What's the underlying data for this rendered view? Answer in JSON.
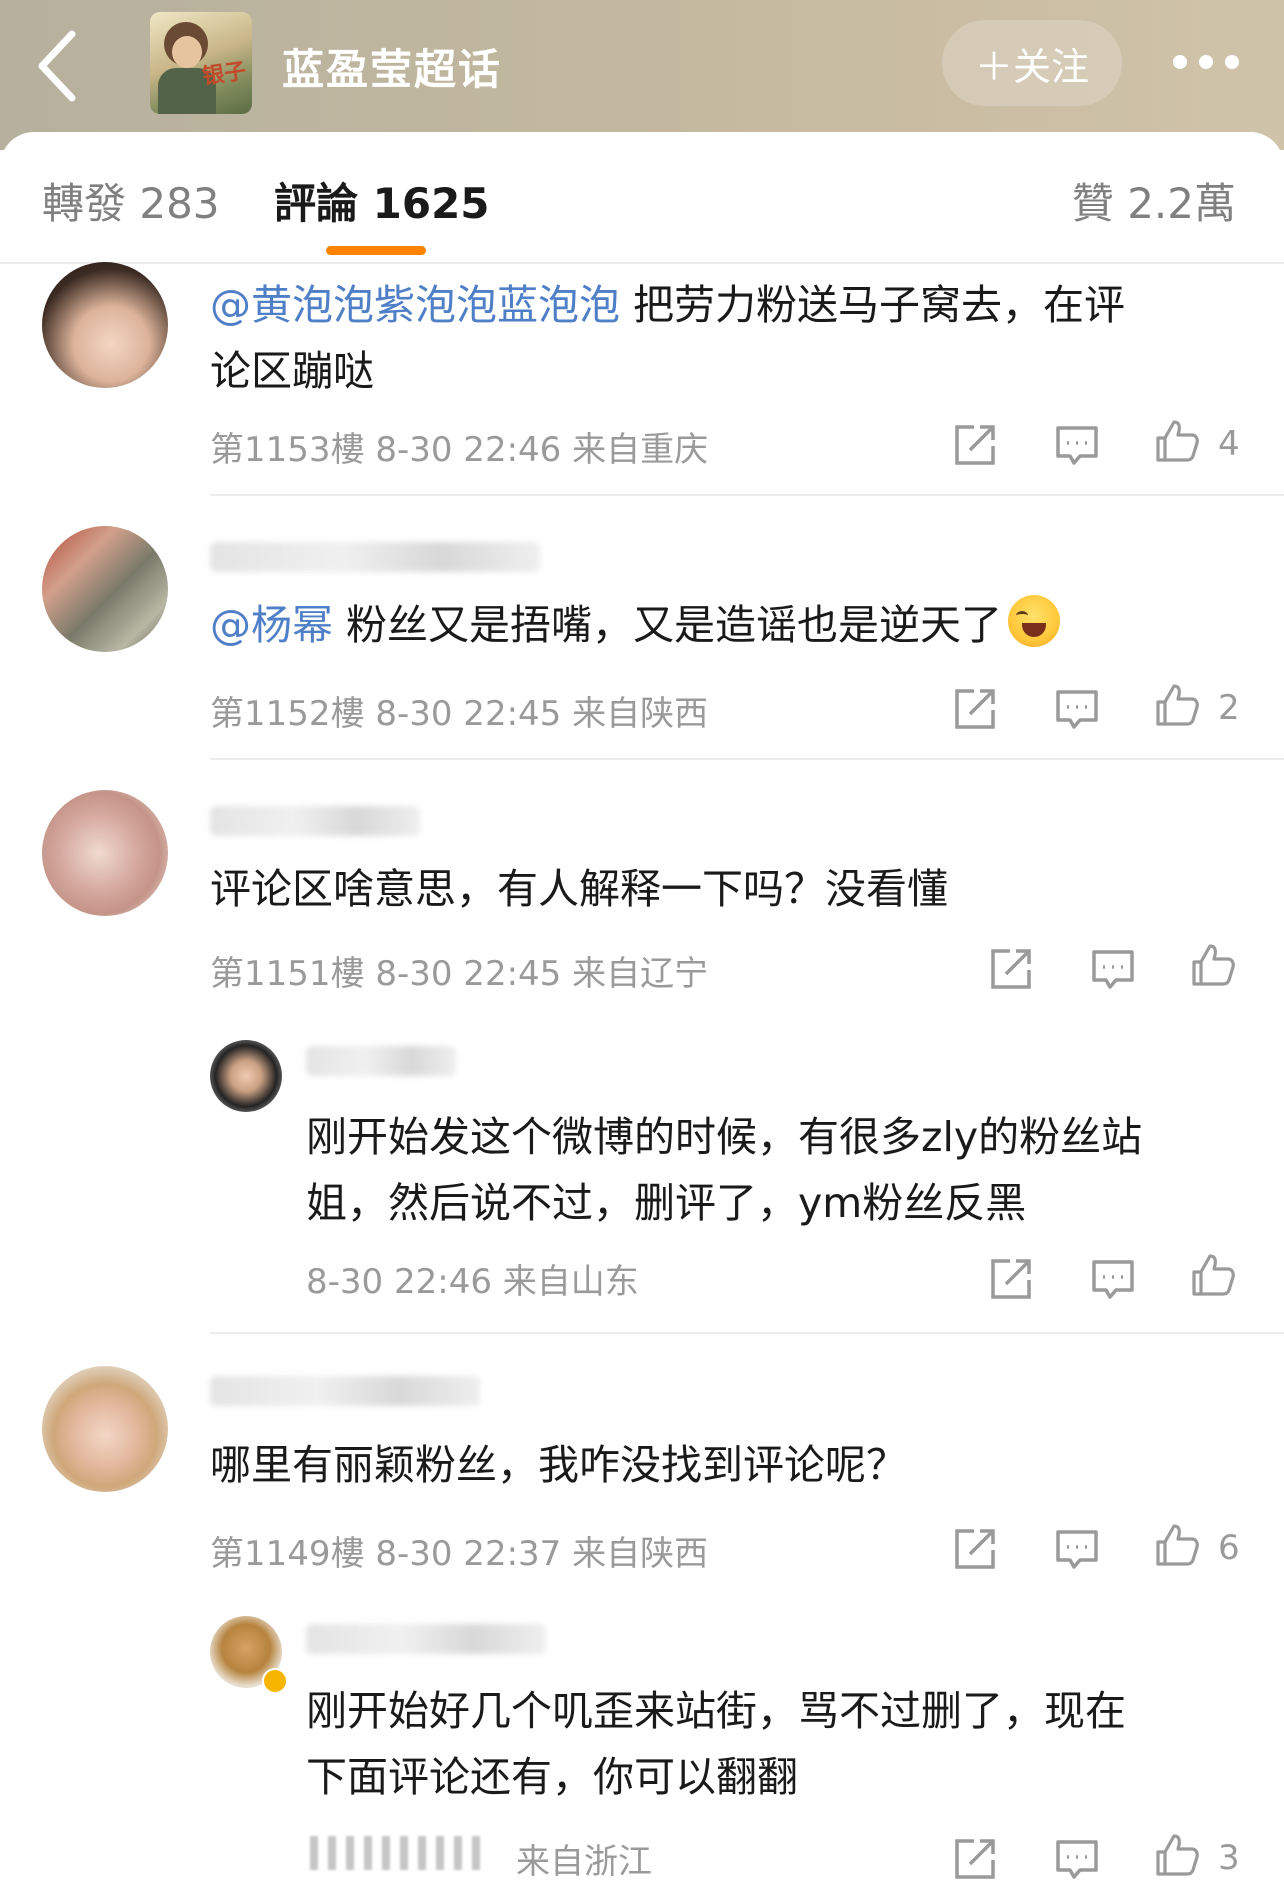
{
  "header": {
    "title": "蓝盈莹超话",
    "follow_label": "＋关注",
    "avatar_text": "银子"
  },
  "tabs": {
    "repost": "轉發 283",
    "comment": "評論 1625",
    "like": "贊 2.2萬",
    "accent": "#ff8200"
  },
  "comments": [
    {
      "mention": "@黄泡泡紫泡泡蓝泡泡",
      "text_line1": " 把劳力粉送马子窝去，在评",
      "text_line2": "论区蹦哒",
      "meta": "第1153樓 8-30 22:46 来自重庆",
      "likes": "4"
    },
    {
      "mention": "@杨幂",
      "text_line1": " 粉丝又是捂嘴，又是造谣也是逆天了",
      "meta": "第1152樓 8-30 22:45 来自陕西",
      "likes": "2"
    },
    {
      "text_line1": "评论区啥意思，有人解释一下吗？没看懂",
      "meta": "第1151樓 8-30 22:45 来自辽宁",
      "likes": "",
      "reply": {
        "text_line1": "刚开始发这个微博的时候，有很多zly的粉丝站",
        "text_line2": "姐，然后说不过，删评了，ym粉丝反黑",
        "meta": "8-30 22:46 来自山东",
        "likes": ""
      }
    },
    {
      "text_line1": "哪里有丽颖粉丝，我咋没找到评论呢？",
      "meta": "第1149樓 8-30 22:37 来自陕西",
      "likes": "6",
      "reply": {
        "text_line1": "刚开始好几个叽歪来站街，骂不过删了，现在",
        "text_line2": "下面评论还有，你可以翻翻",
        "meta": "来自浙江",
        "likes": "3"
      }
    }
  ],
  "icons": [
    "back-arrow-icon",
    "more-dots-icon",
    "repost-icon",
    "reply-icon",
    "like-icon"
  ]
}
